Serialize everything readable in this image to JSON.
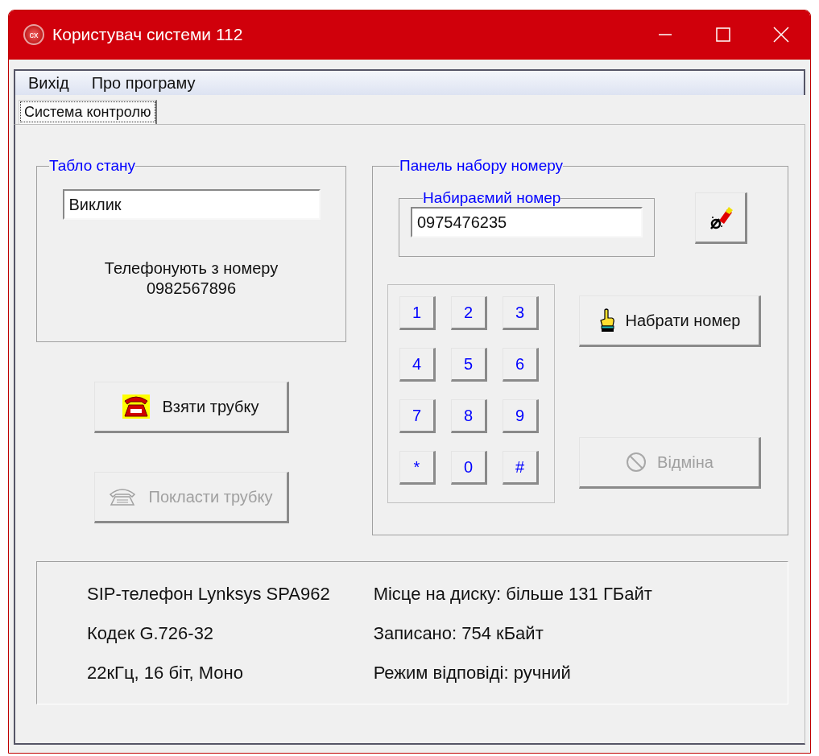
{
  "window": {
    "icon_text": "cx",
    "title": "Користувач системи 112"
  },
  "menu": [
    {
      "label": "Вихід"
    },
    {
      "label": "Про програму"
    }
  ],
  "tabs": [
    {
      "label": "Система контролю",
      "selected": true
    }
  ],
  "status_panel": {
    "title": "Табло стану",
    "field_value": "Виклик",
    "message": "Телефонують з номеру",
    "number": "0982567896"
  },
  "call_buttons": [
    {
      "kind": "pickup",
      "label": "Взяти трубку",
      "disabled": false
    },
    {
      "kind": "hangup",
      "label": "Покласти трубку",
      "disabled": true
    }
  ],
  "dial_panel": {
    "title": "Панель набору номеру",
    "number_group": {
      "title": "Набираємий номер",
      "value": "0975476235"
    },
    "keys": [
      "1",
      "2",
      "3",
      "4",
      "5",
      "6",
      "7",
      "8",
      "9",
      "*",
      "0",
      "#"
    ],
    "buttons": [
      {
        "kind": "dial",
        "label": "Набрати номер",
        "disabled": false
      },
      {
        "kind": "cancel",
        "label": "Відміна",
        "disabled": true
      }
    ]
  },
  "info": {
    "left": [
      "SIP-телефон Lynksys SPA962",
      "Кодек G.726-32",
      "22кГц, 16 біт, Моно"
    ],
    "right": [
      "Місце на диску: більше 131 ГБайт",
      "Записано: 754 кБайт",
      "Режим відповіді: ручний"
    ]
  }
}
